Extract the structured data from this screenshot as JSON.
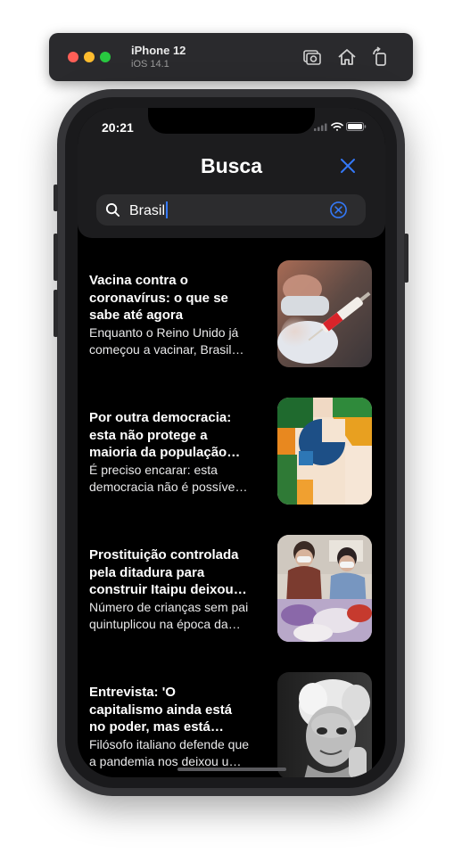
{
  "simulator": {
    "device_name": "iPhone 12",
    "os_version": "iOS 14.1",
    "icons": [
      "screenshot-icon",
      "home-icon",
      "rotate-icon"
    ]
  },
  "status_bar": {
    "time": "20:21"
  },
  "header": {
    "title": "Busca",
    "search": {
      "value": "Brasil"
    }
  },
  "colors": {
    "accent": "#3478f6",
    "background": "#000000",
    "header": "#1c1c1e"
  },
  "articles": [
    {
      "title": "Vacina contra o coronavírus: o que se sabe até agora",
      "description": "Enquanto o Reino Unido já começou a vacinar, Brasil ainda aguarda definição"
    },
    {
      "title": "Por outra democracia: esta não protege a maioria da população brasileira",
      "description": "É preciso encarar: esta democracia não é possível para todos"
    },
    {
      "title": "Prostituição controlada pela ditadura para construir Itaipu deixou marcas",
      "description": "Número de crianças sem pai quintuplicou na época da construção"
    },
    {
      "title": "Entrevista: 'O capitalismo ainda está no poder, mas está morrendo'",
      "description": "Filósofo italiano defende que a pandemia nos deixou uma lição"
    }
  ]
}
